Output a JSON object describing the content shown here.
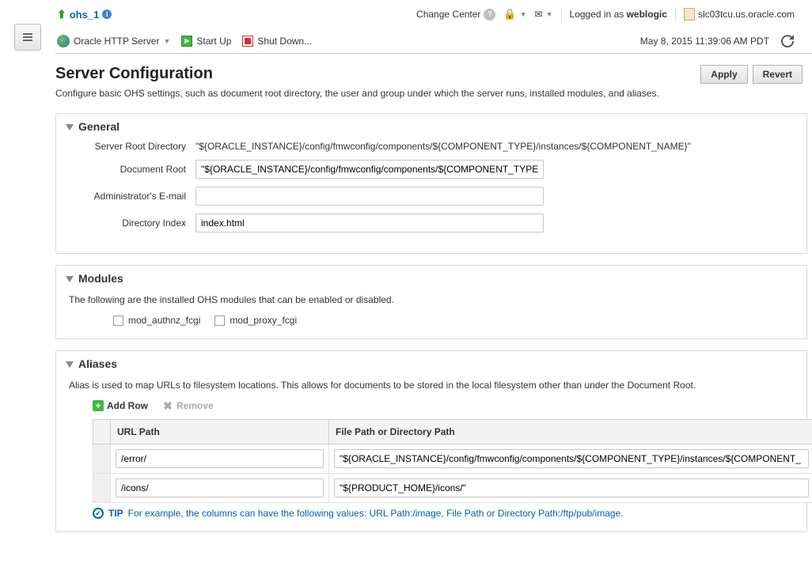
{
  "breadcrumb": {
    "target": "ohs_1"
  },
  "topbar": {
    "change_center": "Change Center",
    "logged_in_prefix": "Logged in as",
    "logged_in_user": "weblogic",
    "hostname": "slc03tcu.us.oracle.com"
  },
  "toolbar": {
    "server_menu": "Oracle HTTP Server",
    "start_up": "Start Up",
    "shut_down": "Shut Down...",
    "timestamp": "May 8, 2015 11:39:06 AM PDT"
  },
  "page": {
    "title": "Server Configuration",
    "description": "Configure basic OHS settings, such as document root directory, the user and group under which the server runs, installed modules, and aliases.",
    "apply": "Apply",
    "revert": "Revert"
  },
  "general": {
    "heading": "General",
    "labels": {
      "server_root": "Server Root Directory",
      "document_root": "Document Root",
      "admin_email": "Administrator's E-mail",
      "directory_index": "Directory Index"
    },
    "values": {
      "server_root": "\"${ORACLE_INSTANCE}/config/fmwconfig/components/${COMPONENT_TYPE}/instances/${COMPONENT_NAME}\"",
      "document_root": "\"${ORACLE_INSTANCE}/config/fmwconfig/components/${COMPONENT_TYPE}",
      "admin_email": "",
      "directory_index": "index.html"
    }
  },
  "modules": {
    "heading": "Modules",
    "note": "The following are the installed OHS modules that can be enabled or disabled.",
    "items": [
      "mod_authnz_fcgi",
      "mod_proxy_fcgi"
    ]
  },
  "aliases": {
    "heading": "Aliases",
    "note": "Alias is used to map URLs to filesystem locations. This allows for documents to be stored in the local filesystem other than under the Document Root.",
    "add_row": "Add Row",
    "remove": "Remove",
    "columns": {
      "url_path": "URL Path",
      "file_path": "File Path or Directory Path"
    },
    "rows": [
      {
        "url": "/error/",
        "path": "\"${ORACLE_INSTANCE}/config/fmwconfig/components/${COMPONENT_TYPE}/instances/${COMPONENT_"
      },
      {
        "url": "/icons/",
        "path": "\"${PRODUCT_HOME}/icons/\""
      }
    ],
    "tip_label": "TIP",
    "tip_text": "For example, the columns can have the following values: URL Path:/image, File Path or Directory Path:/ftp/pub/image."
  }
}
